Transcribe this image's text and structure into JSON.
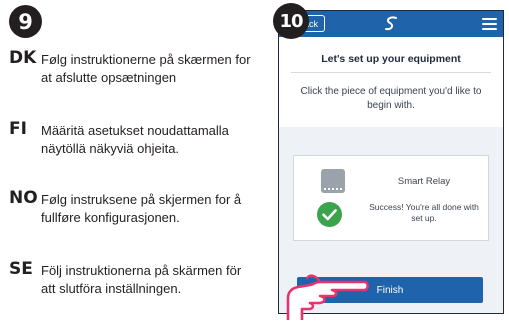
{
  "steps": {
    "step9": "9",
    "step10": "10"
  },
  "instructions": [
    {
      "code": "DK",
      "text": "Følg instruktionerne på skærmen for at afslutte opsætningen"
    },
    {
      "code": "FI",
      "text": "Määritä asetukset noudattamalla näytöllä näkyviä ohjeita."
    },
    {
      "code": "NO",
      "text": "Følg instruksene på skjermen for å fullføre konfigurasjonen."
    },
    {
      "code": "SE",
      "text": "Följ instruktionerna på skärmen för att slutföra inställningen."
    }
  ],
  "app": {
    "back_label": "Back",
    "setup_title": "Let's set up your equipment",
    "setup_subtitle": "Click the piece of equipment you'd like to begin with.",
    "device": {
      "name": "Smart Relay",
      "status": "Success! You're all done with set up."
    },
    "finish_label": "Finish"
  },
  "colors": {
    "brand_blue": "#1f63ab",
    "success_green": "#3aa34b",
    "pointer_pink": "#e8336d"
  },
  "icons": [
    "logo-icon",
    "menu-icon",
    "smart-relay-icon",
    "check-icon",
    "pointing-hand-icon"
  ]
}
